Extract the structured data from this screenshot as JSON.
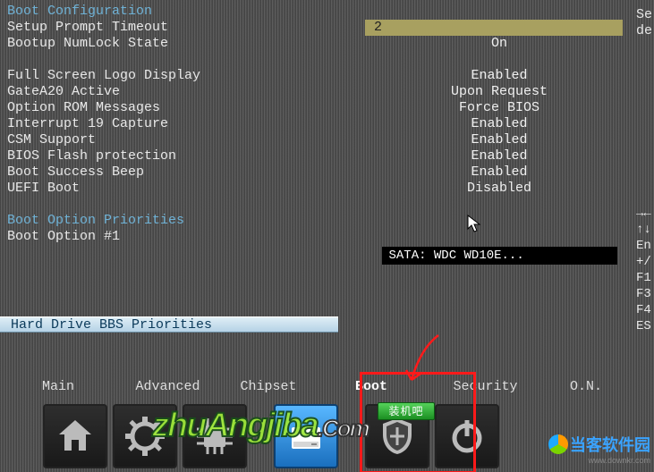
{
  "left": {
    "heading1": "Boot Configuration",
    "rows1": [
      "Setup Prompt Timeout",
      "Bootup NumLock State"
    ],
    "rows2": [
      "Full Screen Logo Display",
      "GateA20 Active",
      "Option ROM Messages",
      "Interrupt 19 Capture",
      "CSM Support",
      "BIOS Flash protection",
      "Boot Success Beep",
      "UEFI Boot"
    ],
    "heading2": "Boot Option Priorities",
    "rows3": [
      "Boot Option #1"
    ],
    "selected": "Hard Drive BBS Priorities"
  },
  "right": {
    "timeout": "2",
    "numlock": "On",
    "values2": [
      "Enabled",
      "Upon Request",
      "Force BIOS",
      "Enabled",
      "Enabled",
      "Enabled",
      "Enabled",
      "Disabled"
    ],
    "boot_device": "SATA: WDC WD10E..."
  },
  "side_top": [
    "Se",
    "de"
  ],
  "side_hints": [
    "→←",
    "↑↓",
    "En",
    "+/",
    "F1",
    "F3",
    "F4",
    "ES"
  ],
  "tabs": [
    {
      "label": "Main",
      "name": "tab-main"
    },
    {
      "label": "Advanced",
      "name": "tab-advanced"
    },
    {
      "label": "Chipset",
      "name": "tab-chipset"
    },
    {
      "label": "Boot",
      "name": "tab-boot",
      "active": true
    },
    {
      "label": "Security",
      "name": "tab-security"
    },
    {
      "label": "O.N.",
      "name": "tab-on"
    }
  ],
  "watermark1": "zhuAngjiba",
  "watermark1_suffix": ".Com",
  "watermark1_badge": "装机吧",
  "watermark2": "当客软件园",
  "watermark2_sub": "www.downkr.com"
}
